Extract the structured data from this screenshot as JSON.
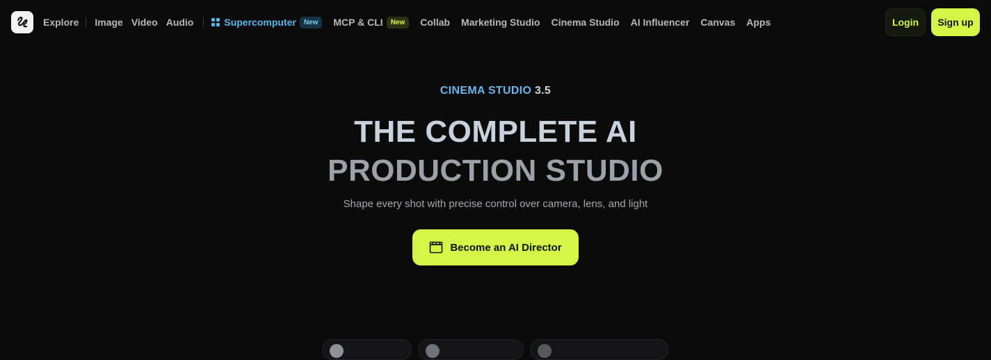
{
  "nav": {
    "explore": "Explore",
    "image": "Image",
    "video": "Video",
    "audio": "Audio",
    "supercomputer": "Supercomputer",
    "supercomputer_badge": "New",
    "mcp": "MCP & CLI",
    "mcp_badge": "New",
    "collab": "Collab",
    "marketing": "Marketing Studio",
    "cinema": "Cinema Studio",
    "influencer": "AI Influencer",
    "canvas": "Canvas",
    "apps": "Apps"
  },
  "auth": {
    "login": "Login",
    "signup": "Sign up"
  },
  "hero": {
    "kicker_brand": "CINEMA STUDIO",
    "kicker_version": "3.5",
    "headline_line1": "THE COMPLETE AI",
    "headline_line2": "PRODUCTION STUDIO",
    "subtitle": "Shape every shot with precise control over camera, lens, and light",
    "cta": "Become an AI Director"
  },
  "colors": {
    "accent": "#d4f545",
    "supercomputer": "#55b8ec",
    "background": "#0b0b0c"
  },
  "icons": [
    "logo-icon",
    "supercomputer-icon",
    "clapperboard-icon"
  ]
}
